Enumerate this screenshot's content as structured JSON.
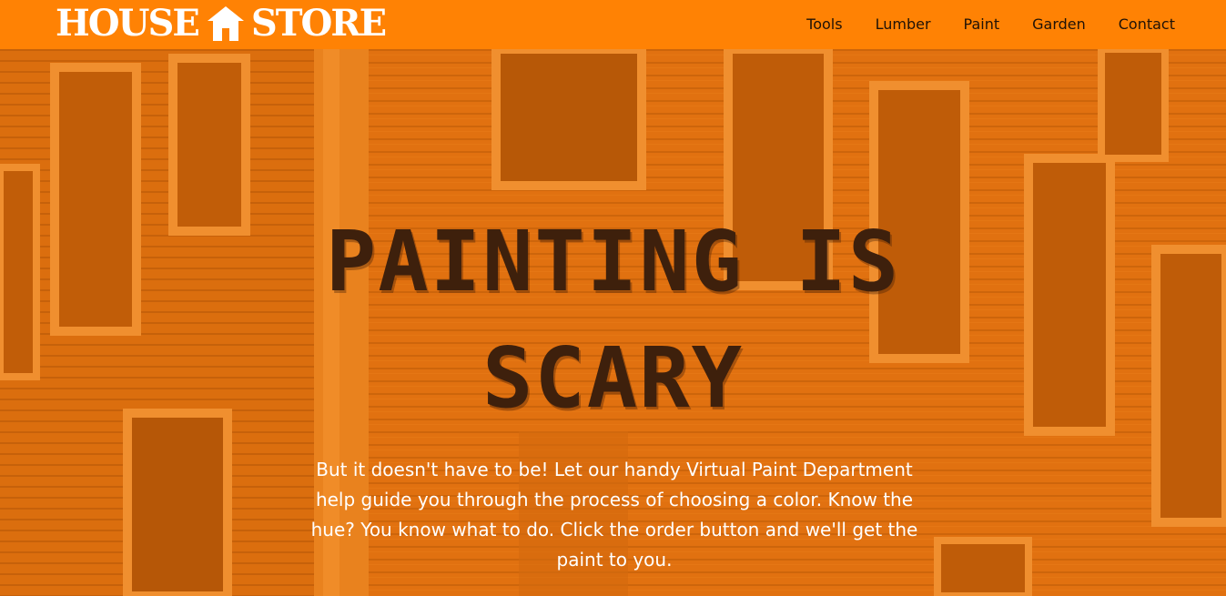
{
  "header": {
    "logo_left": "HOUSE",
    "logo_right": "STORE",
    "logo_icon": "house-icon",
    "nav": [
      {
        "label": "Tools"
      },
      {
        "label": "Lumber"
      },
      {
        "label": "Paint"
      },
      {
        "label": "Garden"
      },
      {
        "label": "Contact"
      }
    ]
  },
  "hero": {
    "title": "PAINTING IS SCARY",
    "body": "But it doesn't have to be! Let our handy Virtual Paint Department help guide you through the process of choosing a color. Know the hue? You know what to do. Click the order button and we'll get the paint to you."
  },
  "colors": {
    "header_bg": "#ff8204",
    "title_text": "#3e200c",
    "body_text": "#ffffff"
  }
}
